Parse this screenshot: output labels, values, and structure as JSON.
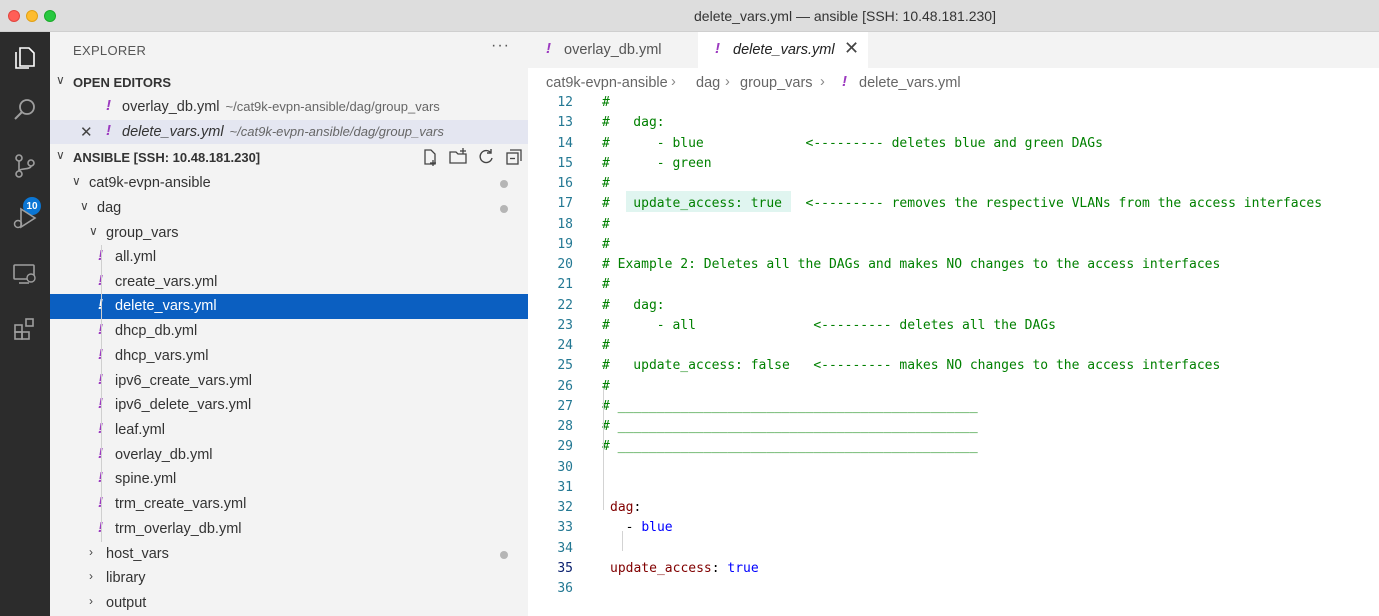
{
  "window": {
    "title": "delete_vars.yml — ansible [SSH: 10.48.181.230]"
  },
  "activity_bar": {
    "scm_badge": "10"
  },
  "explorer": {
    "title": "EXPLORER",
    "more": "···",
    "open_editors": {
      "title": "OPEN EDITORS",
      "items": [
        {
          "name": "overlay_db.yml",
          "path": "~/cat9k-evpn-ansible/dag/group_vars"
        },
        {
          "name": "delete_vars.yml",
          "path": "~/cat9k-evpn-ansible/dag/group_vars"
        }
      ]
    },
    "workspace": {
      "title": "ANSIBLE [SSH: 10.48.181.230]",
      "root": "cat9k-evpn-ansible",
      "dag": "dag",
      "group_vars": "group_vars",
      "files": [
        "all.yml",
        "create_vars.yml",
        "delete_vars.yml",
        "dhcp_db.yml",
        "dhcp_vars.yml",
        "ipv6_create_vars.yml",
        "ipv6_delete_vars.yml",
        "leaf.yml",
        "overlay_db.yml",
        "spine.yml",
        "trm_create_vars.yml",
        "trm_overlay_db.yml"
      ],
      "host_vars": "host_vars",
      "library": "library",
      "output": "output"
    }
  },
  "tabs": [
    {
      "label": "overlay_db.yml"
    },
    {
      "label": "delete_vars.yml"
    }
  ],
  "breadcrumb": [
    "cat9k-evpn-ansible",
    "dag",
    "group_vars",
    "delete_vars.yml"
  ],
  "code_lines": [
    {
      "n": "12",
      "text": "#"
    },
    {
      "n": "13",
      "text": "#   dag:"
    },
    {
      "n": "14",
      "text": "#      - blue             <--------- deletes blue and green DAGs"
    },
    {
      "n": "15",
      "text": "#      - green"
    },
    {
      "n": "16",
      "text": "#"
    },
    {
      "n": "17",
      "text": "#   update_access: true   <--------- removes the respective VLANs from the access interfaces"
    },
    {
      "n": "18",
      "text": "#"
    },
    {
      "n": "19",
      "text": "#"
    },
    {
      "n": "20",
      "text": "# Example 2: Deletes all the DAGs and makes NO changes to the access interfaces"
    },
    {
      "n": "21",
      "text": "#"
    },
    {
      "n": "22",
      "text": "#   dag:"
    },
    {
      "n": "23",
      "text": "#      - all               <--------- deletes all the DAGs"
    },
    {
      "n": "24",
      "text": "#"
    },
    {
      "n": "25",
      "text": "#   update_access: false   <--------- makes NO changes to the access interfaces"
    },
    {
      "n": "26",
      "text": "#"
    },
    {
      "n": "27",
      "text": "# ______________________________________________"
    },
    {
      "n": "28",
      "text": "# ______________________________________________"
    },
    {
      "n": "29",
      "text": "# ______________________________________________"
    },
    {
      "n": "30",
      "text": ""
    },
    {
      "n": "31",
      "text": ""
    },
    {
      "n": "32",
      "key": "dag",
      "sep": ":"
    },
    {
      "n": "33",
      "dash": "  - ",
      "val": "blue"
    },
    {
      "n": "34",
      "text": ""
    },
    {
      "n": "35",
      "key": "update_access",
      "sep": ": ",
      "val": "true"
    },
    {
      "n": "36",
      "text": ""
    }
  ],
  "colors": {
    "comment": "#008000",
    "key": "#800000",
    "value": "#0000ff",
    "line_number": "#237893",
    "selection": "#0b5fc1",
    "badge": "#0b76d4",
    "yml_icon": "#9c3ac0"
  }
}
